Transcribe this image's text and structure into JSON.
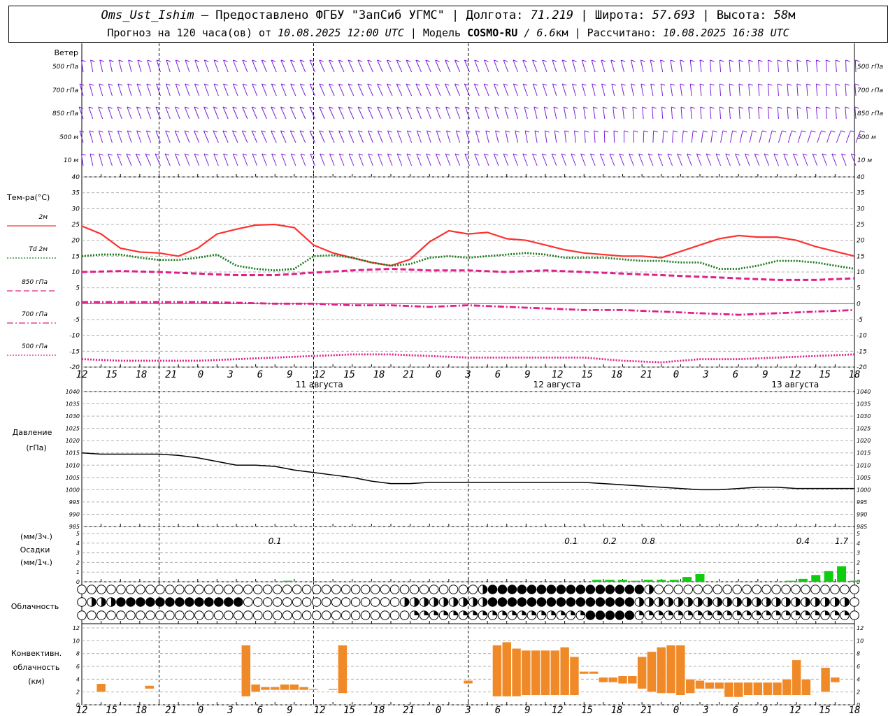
{
  "header": {
    "station": "Oms_Ust_Ishim",
    "provider": "– Предоставлено ФГБУ \"ЗапСиб УГМС\" |",
    "lon_label": "Долгота:",
    "lon_value": "71.219",
    "lat_label": "| Широта:",
    "lat_value": "57.693",
    "alt_label": "| Высота:",
    "alt_value": "58",
    "alt_unit": "м",
    "forecast_label": "Прогноз на 120 часа(ов) от",
    "forecast_time": "10.08.2025 12:00 UTC",
    "model_label": "| Модель",
    "model_name": "COSMO-RU",
    "model_res": "/ 6.6",
    "model_res_unit": "км",
    "calc_label": "| Рассчитано:",
    "calc_time": "10.08.2025 16:38 UTC"
  },
  "axis": {
    "hour_labels": [
      "12",
      "15",
      "18",
      "21",
      "0",
      "3",
      "6",
      "9",
      "12",
      "15",
      "18",
      "21",
      "0",
      "3",
      "6",
      "9",
      "12",
      "15",
      "18",
      "21",
      "0",
      "3",
      "6",
      "9",
      "12",
      "15",
      "18"
    ],
    "day_labels": [
      {
        "hour_index": 12,
        "text": "11 августа"
      },
      {
        "hour_index": 36,
        "text": "12 августа"
      },
      {
        "hour_index": 60,
        "text": "13 августа"
      }
    ],
    "midnight_hours": [
      12,
      36,
      60
    ]
  },
  "wind": {
    "title": "Ветер",
    "levels": [
      "500 гПа",
      "700 гПа",
      "850 гПа",
      "500 м",
      "10 м"
    ],
    "right_levels": [
      "500 гПа",
      "700 гПа",
      "850 гПа",
      "500 м",
      "10 м"
    ],
    "color": "#7a1fd9"
  },
  "temperature": {
    "title": "Тем-ра(°С)",
    "legend": [
      {
        "label": "2м",
        "color": "#ff3030",
        "style": "solid"
      },
      {
        "label": "Td  2м",
        "color": "#1a7a1a",
        "style": "dotted"
      },
      {
        "label": "850 гПа",
        "color": "#e0208a",
        "style": "dashed"
      },
      {
        "label": "700 гПа",
        "color": "#e0208a",
        "style": "dashdot"
      },
      {
        "label": "500 гПа",
        "color": "#e0208a",
        "style": "dotted"
      }
    ],
    "yticks": [
      40,
      35,
      30,
      25,
      20,
      15,
      10,
      5,
      0,
      -5,
      -10,
      -15,
      -20
    ]
  },
  "pressure": {
    "title": "Давление",
    "unit": "(гПа)",
    "yticks": [
      1040,
      1035,
      1030,
      1025,
      1020,
      1015,
      1010,
      1005,
      1000,
      995,
      990,
      985
    ]
  },
  "precip": {
    "unit3": "(мм/3ч.)",
    "title": "Осадки",
    "unit1": "(мм/1ч.)",
    "yticks": [
      5,
      4,
      3,
      2,
      1,
      0
    ],
    "totals": [
      {
        "hour": 15,
        "value": "0.1"
      },
      {
        "hour": 38,
        "value": "0.1"
      },
      {
        "hour": 41,
        "value": "0.2"
      },
      {
        "hour": 44,
        "value": "0.8"
      },
      {
        "hour": 56,
        "value": "0.4"
      },
      {
        "hour": 59,
        "value": "1.7"
      }
    ],
    "color": "#10cc10"
  },
  "clouds": {
    "title": "Облачность"
  },
  "convective": {
    "title1": "Конвективн.",
    "title2": "облачность",
    "unit": "(км)",
    "yticks": [
      12,
      10,
      8,
      6,
      4,
      2,
      0
    ],
    "color": "#f08a28"
  },
  "chart_data": [
    {
      "type": "line",
      "title": "Тем-ра(°С)",
      "x_unit": "hours since 10.08.2025 12:00 UTC",
      "ylim": [
        -20,
        40
      ],
      "series": [
        {
          "name": "2м",
          "color": "#ff3030",
          "x": [
            0,
            3,
            6,
            9,
            12,
            15,
            18,
            21,
            24,
            27,
            30,
            33,
            36,
            39,
            42,
            45,
            48,
            51,
            54,
            57,
            60,
            63,
            66,
            69,
            72,
            75,
            78,
            81,
            84,
            87,
            90,
            93,
            96,
            99,
            102,
            105,
            108,
            111,
            114,
            117,
            120
          ],
          "values": [
            24.5,
            22,
            17.5,
            16.3,
            16,
            15,
            17.5,
            22,
            23.5,
            24.8,
            25,
            24,
            18.5,
            16,
            14.5,
            13,
            12,
            14,
            19.5,
            23,
            22,
            22.5,
            20.5,
            20,
            18.5,
            17,
            16,
            15.5,
            15,
            15,
            14.5,
            16.5,
            18.5,
            20.5,
            21.5,
            21,
            21,
            20,
            18,
            16.5,
            15
          ]
        },
        {
          "name": "Td 2м",
          "color": "#1a7a1a",
          "x": [
            0,
            3,
            6,
            9,
            12,
            15,
            18,
            21,
            24,
            27,
            30,
            33,
            36,
            39,
            42,
            45,
            48,
            51,
            54,
            57,
            60,
            63,
            66,
            69,
            72,
            75,
            78,
            81,
            84,
            87,
            90,
            93,
            96,
            99,
            102,
            105,
            108,
            111,
            114,
            117,
            120
          ],
          "values": [
            15,
            15.5,
            15.5,
            14.5,
            13.8,
            13.8,
            14.5,
            15.5,
            12,
            11,
            10.5,
            11,
            15,
            15.3,
            14.5,
            13,
            12,
            12.5,
            14.5,
            15,
            14.5,
            15,
            15.5,
            16,
            15.5,
            14.5,
            14.5,
            14.5,
            14,
            13.5,
            13.5,
            13,
            13,
            11,
            11,
            12,
            13.5,
            13.5,
            13,
            12,
            11
          ]
        },
        {
          "name": "850 гПа",
          "color": "#e0208a",
          "x": [
            0,
            6,
            12,
            18,
            24,
            30,
            36,
            42,
            48,
            54,
            60,
            66,
            72,
            78,
            84,
            90,
            96,
            102,
            108,
            114,
            120
          ],
          "values": [
            10,
            10.3,
            10,
            9.5,
            9,
            9,
            9.8,
            10.5,
            11,
            10.5,
            10.5,
            10,
            10.5,
            10,
            9.5,
            9,
            8.5,
            8,
            7.5,
            7.5,
            8
          ]
        },
        {
          "name": "700 гПа",
          "color": "#e0208a",
          "x": [
            0,
            6,
            12,
            18,
            24,
            30,
            36,
            42,
            48,
            54,
            60,
            66,
            72,
            78,
            84,
            90,
            96,
            102,
            108,
            114,
            120
          ],
          "values": [
            0.5,
            0.5,
            0.5,
            0.5,
            0.3,
            0,
            0,
            -0.5,
            -0.5,
            -1,
            -0.5,
            -1,
            -1.5,
            -2,
            -2,
            -2.5,
            -3,
            -3.5,
            -3,
            -2.5,
            -2
          ]
        },
        {
          "name": "500 гПа",
          "color": "#e0208a",
          "x": [
            0,
            6,
            12,
            18,
            24,
            30,
            36,
            42,
            48,
            54,
            60,
            66,
            72,
            78,
            84,
            90,
            96,
            102,
            108,
            114,
            120
          ],
          "values": [
            -17.5,
            -18,
            -18,
            -18,
            -17.5,
            -17,
            -16.5,
            -16,
            -16,
            -16.5,
            -17,
            -17,
            -17,
            -17,
            -18,
            -18.5,
            -17.5,
            -17.5,
            -17,
            -16.5,
            -16
          ]
        }
      ]
    },
    {
      "type": "line",
      "title": "Давление",
      "ylabel": "(гПа)",
      "ylim": [
        985,
        1040
      ],
      "series": [
        {
          "name": "",
          "color": "#000000",
          "x": [
            0,
            3,
            6,
            9,
            12,
            15,
            18,
            21,
            24,
            27,
            30,
            33,
            36,
            39,
            42,
            45,
            48,
            51,
            54,
            57,
            60,
            63,
            66,
            69,
            72,
            75,
            78,
            81,
            84,
            87,
            90,
            93,
            96,
            99,
            102,
            105,
            108,
            111,
            114,
            117,
            120
          ],
          "values": [
            1015,
            1014.5,
            1014.5,
            1014.5,
            1014.5,
            1014,
            1013,
            1011.5,
            1010,
            1010,
            1009.5,
            1008,
            1007,
            1006,
            1005,
            1003.5,
            1002.5,
            1002.5,
            1003,
            1003,
            1003,
            1003,
            1003,
            1003,
            1003,
            1003,
            1003,
            1002.5,
            1002,
            1001.5,
            1001,
            1000.5,
            1000,
            1000,
            1000.5,
            1001,
            1001,
            1000.5,
            1000.5,
            1000.5,
            1000.5
          ]
        }
      ]
    },
    {
      "type": "bar",
      "title": "Осадки",
      "ylim": [
        0,
        5
      ],
      "x": [
        20,
        45,
        46,
        47,
        48,
        49,
        50,
        51,
        52,
        53,
        54,
        55,
        56,
        57,
        58,
        59,
        60,
        61,
        62,
        63,
        64,
        65,
        66,
        67,
        68,
        69,
        70,
        71,
        72,
        73,
        74,
        75,
        76,
        77,
        78,
        79,
        80,
        81,
        82,
        83,
        84,
        85,
        86,
        87,
        88,
        89,
        90,
        91,
        92,
        93,
        94,
        95,
        96,
        97,
        98,
        99,
        100,
        101,
        102,
        103,
        104,
        105,
        106,
        107,
        108,
        109,
        110,
        111,
        112,
        113,
        114,
        115,
        116,
        117,
        118,
        119,
        120
      ],
      "values": [
        0.1,
        0,
        0,
        0,
        0,
        0,
        0,
        0,
        0,
        0,
        0,
        0,
        0,
        0,
        0,
        0,
        0,
        0,
        0,
        0,
        0,
        0,
        0,
        0,
        0,
        0,
        0,
        0,
        0,
        0,
        0,
        0,
        0,
        0,
        0,
        0,
        0,
        0,
        0,
        0,
        0,
        0,
        0,
        0,
        0,
        0,
        0,
        0,
        0,
        0,
        0,
        0,
        0,
        0,
        0,
        0,
        0,
        0,
        0,
        0,
        0,
        0,
        0,
        0,
        0,
        0,
        0,
        0,
        0,
        0,
        0,
        0,
        0,
        0,
        0,
        0,
        0
      ],
      "bars": [
        {
          "x": 16,
          "value": 0.1
        },
        {
          "x": 40,
          "value": 0.2
        },
        {
          "x": 41,
          "value": 0.2
        },
        {
          "x": 42,
          "value": 0.2
        },
        {
          "x": 43,
          "value": 0.1
        },
        {
          "x": 44,
          "value": 0.2
        },
        {
          "x": 45,
          "value": 0.2
        },
        {
          "x": 46,
          "value": 0.2
        },
        {
          "x": 47,
          "value": 0.5
        },
        {
          "x": 48,
          "value": 0.8
        },
        {
          "x": 55,
          "value": 0.1
        },
        {
          "x": 56,
          "value": 0.3
        },
        {
          "x": 57,
          "value": 0.7
        },
        {
          "x": 58,
          "value": 1.1
        },
        {
          "x": 59,
          "value": 1.6
        },
        {
          "x": 60,
          "value": 0.1
        },
        {
          "x": 80,
          "value": 0.1
        }
      ]
    },
    {
      "type": "bar",
      "title": "Конвективн. облачность",
      "ylabel": "(км)",
      "ylim": [
        0,
        12
      ],
      "ranges": [
        {
          "x": 2,
          "base": 2,
          "top": 3.3
        },
        {
          "x": 7,
          "base": 2.5,
          "top": 3
        },
        {
          "x": 17,
          "base": 1.3,
          "top": 9.3
        },
        {
          "x": 18,
          "base": 2,
          "top": 3.2
        },
        {
          "x": 19,
          "base": 2.3,
          "top": 2.8
        },
        {
          "x": 20,
          "base": 2.3,
          "top": 2.8
        },
        {
          "x": 21,
          "base": 2.3,
          "top": 3.2
        },
        {
          "x": 22,
          "base": 2.3,
          "top": 3.2
        },
        {
          "x": 23,
          "base": 2.3,
          "top": 2.8
        },
        {
          "x": 24,
          "base": 2.3,
          "top": 2.5
        },
        {
          "x": 26,
          "base": 2.3,
          "top": 2.5
        },
        {
          "x": 27,
          "base": 1.8,
          "top": 9.3
        },
        {
          "x": 40,
          "base": 3.8,
          "top": 3.3
        },
        {
          "x": 43,
          "base": 1.3,
          "top": 9.3
        },
        {
          "x": 44,
          "base": 1.3,
          "top": 9.8
        },
        {
          "x": 45,
          "base": 1.3,
          "top": 8.8
        },
        {
          "x": 46,
          "base": 1.5,
          "top": 8.5
        },
        {
          "x": 47,
          "base": 1.5,
          "top": 8.5
        },
        {
          "x": 48,
          "base": 1.5,
          "top": 8.5
        },
        {
          "x": 49,
          "base": 1.5,
          "top": 8.5
        },
        {
          "x": 50,
          "base": 1.5,
          "top": 9.0
        },
        {
          "x": 51,
          "base": 1.5,
          "top": 7.5
        },
        {
          "x": 52,
          "base": 4.8,
          "top": 5.2
        },
        {
          "x": 53,
          "base": 4.8,
          "top": 5.2
        },
        {
          "x": 54,
          "base": 3.5,
          "top": 4.3
        },
        {
          "x": 55,
          "base": 3.5,
          "top": 4.3
        },
        {
          "x": 56,
          "base": 3.3,
          "top": 4.5
        },
        {
          "x": 57,
          "base": 3.3,
          "top": 4.5
        },
        {
          "x": 58,
          "base": 2.5,
          "top": 7.5
        },
        {
          "x": 59,
          "base": 2.0,
          "top": 8.3
        },
        {
          "x": 60,
          "base": 1.8,
          "top": 9.0
        },
        {
          "x": 61,
          "base": 1.8,
          "top": 9.3
        },
        {
          "x": 62,
          "base": 1.5,
          "top": 9.3
        },
        {
          "x": 63,
          "base": 1.8,
          "top": 4.0
        },
        {
          "x": 64,
          "base": 2.5,
          "top": 3.8
        },
        {
          "x": 65,
          "base": 2.5,
          "top": 3.5
        },
        {
          "x": 66,
          "base": 2.5,
          "top": 3.5
        },
        {
          "x": 67,
          "base": 1.2,
          "top": 3.5
        },
        {
          "x": 68,
          "base": 1.2,
          "top": 3.5
        },
        {
          "x": 69,
          "base": 1.5,
          "top": 3.5
        },
        {
          "x": 70,
          "base": 1.5,
          "top": 3.5
        },
        {
          "x": 71,
          "base": 1.5,
          "top": 3.5
        },
        {
          "x": 72,
          "base": 1.5,
          "top": 3.5
        },
        {
          "x": 73,
          "base": 1.5,
          "top": 4.0
        },
        {
          "x": 74,
          "base": 1.5,
          "top": 7.0
        },
        {
          "x": 75,
          "base": 1.5,
          "top": 4.0
        },
        {
          "x": 77,
          "base": 2.0,
          "top": 5.8
        },
        {
          "x": 78,
          "base": 3.5,
          "top": 4.3
        }
      ]
    }
  ]
}
